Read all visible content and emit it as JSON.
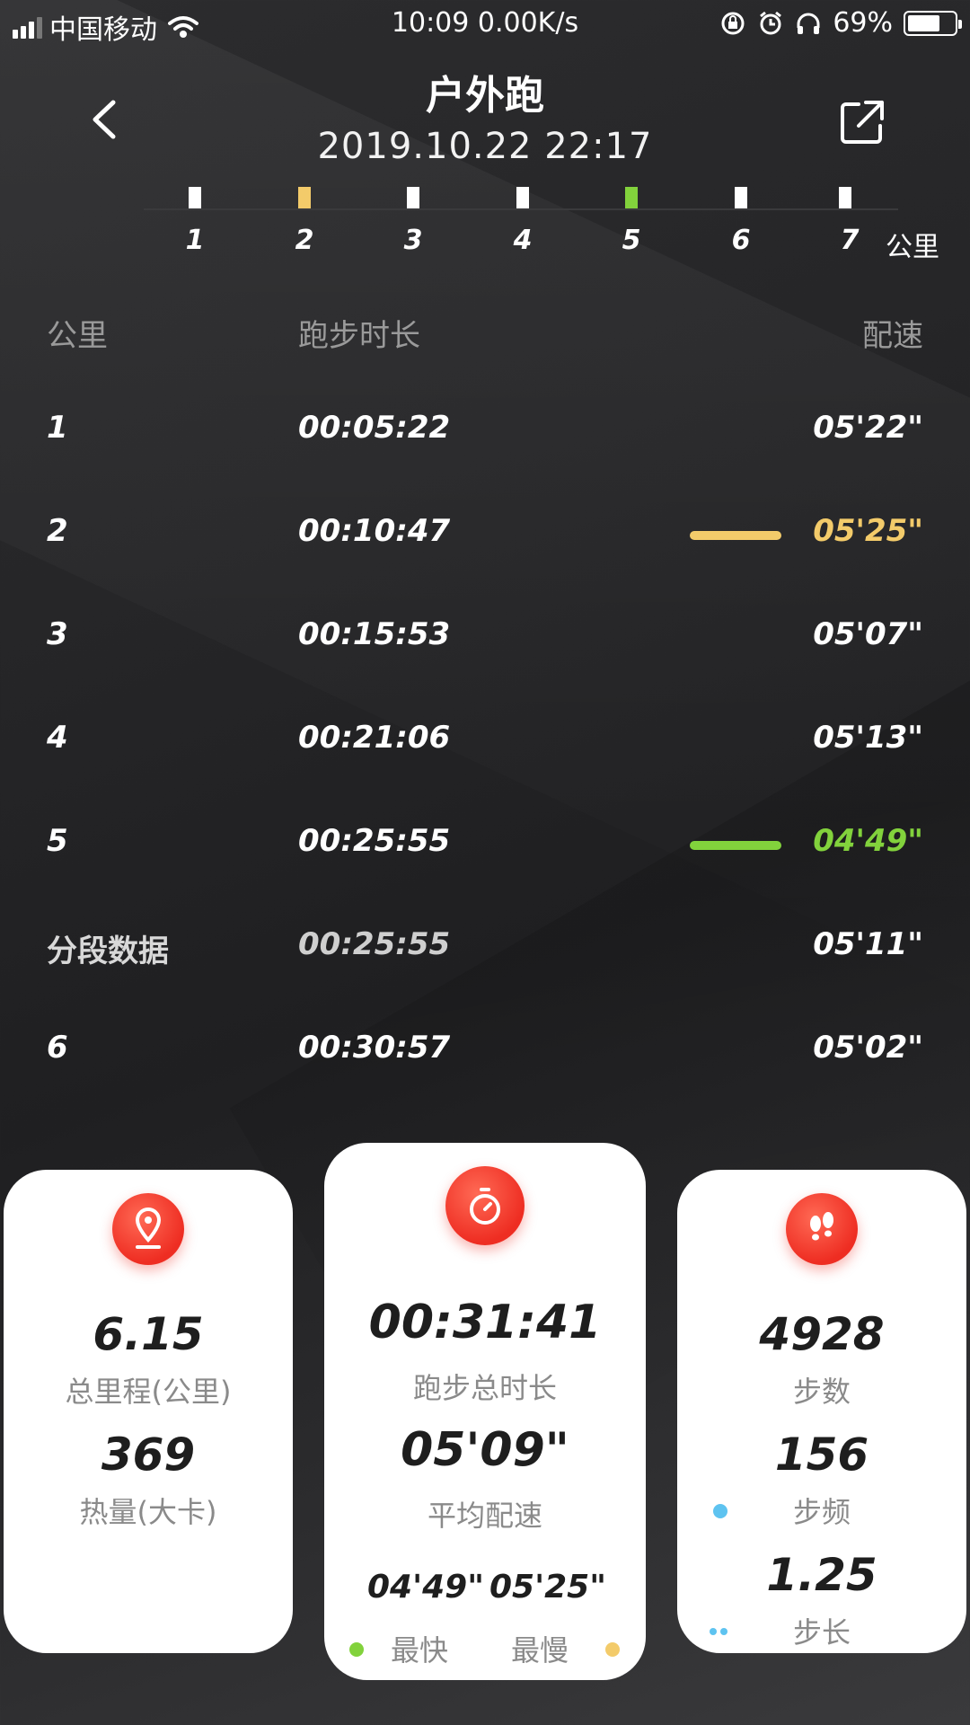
{
  "status_bar": {
    "carrier": "中国移动",
    "time_speed": "10:09 0.00K/s",
    "battery": "69%",
    "battery_level": 0.69
  },
  "header": {
    "title": "户外跑",
    "datetime": "2019.10.22 22:17"
  },
  "km_timeline": {
    "ticks": [
      "1",
      "2",
      "3",
      "4",
      "5",
      "6",
      "7"
    ],
    "unit": "公里",
    "highlight_slow": "2",
    "highlight_fast": "5"
  },
  "table": {
    "headers": {
      "km": "公里",
      "duration": "跑步时长",
      "pace": "配速"
    },
    "rows": [
      {
        "km": "1",
        "duration": "00:05:22",
        "pace": "05'22\""
      },
      {
        "km": "2",
        "duration": "00:10:47",
        "pace": "05'25\"",
        "marker": "slowest"
      },
      {
        "km": "3",
        "duration": "00:15:53",
        "pace": "05'07\""
      },
      {
        "km": "4",
        "duration": "00:21:06",
        "pace": "05'13\""
      },
      {
        "km": "5",
        "duration": "00:25:55",
        "pace": "04'49\"",
        "marker": "fastest"
      },
      {
        "km": "分段数据",
        "duration": "00:25:55",
        "pace": "05'11\""
      },
      {
        "km": "6",
        "duration": "00:30:57",
        "pace": "05'02\""
      }
    ]
  },
  "cards": {
    "distance": {
      "icon": "location-pin-icon",
      "value": "6.15",
      "label": "总里程(公里)",
      "calories": "369",
      "calories_label": "热量(大卡)"
    },
    "time": {
      "icon": "stopwatch-icon",
      "value": "00:31:41",
      "label": "跑步总时长",
      "avg_pace": "05'09\"",
      "avg_pace_label": "平均配速",
      "fastest": "04'49\"",
      "slowest": "05'25\"",
      "fastest_label": "最快",
      "slowest_label": "最慢"
    },
    "steps": {
      "icon": "footprints-icon",
      "value": "4928",
      "label": "步数",
      "cadence": "156",
      "cadence_label": "步频",
      "stride": "1.25",
      "stride_label": "步长"
    }
  },
  "colors": {
    "fast": "#82d23c",
    "slow": "#f3cb6a",
    "accent_red": "#ee2d22",
    "dot_blue": "#5ec3f0"
  }
}
